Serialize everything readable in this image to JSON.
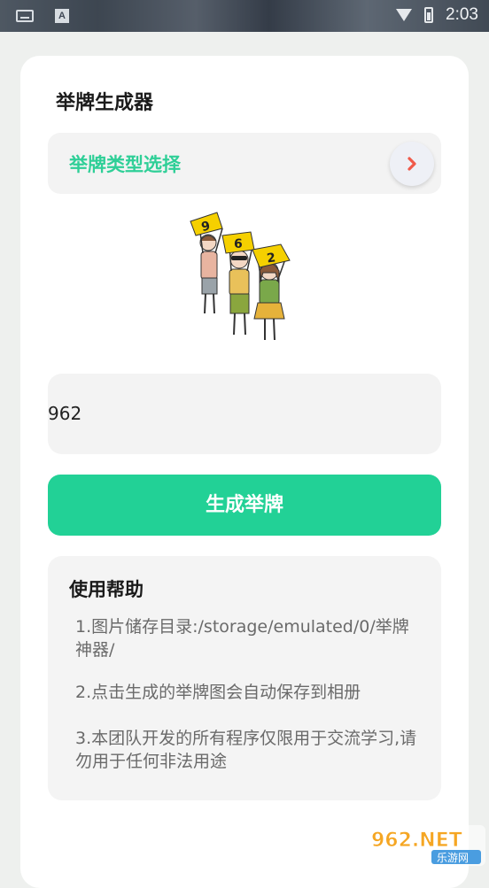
{
  "status_bar": {
    "time": "2:03",
    "icons": [
      "keyboard-icon",
      "a-icon",
      "wifi-icon",
      "battery-icon"
    ]
  },
  "header": {
    "title": "举牌生成器"
  },
  "type_select": {
    "label": "举牌类型选择",
    "icon": "chevron-right-icon"
  },
  "illustration": {
    "signs": [
      "9",
      "6",
      "2"
    ]
  },
  "input": {
    "value": "962"
  },
  "generate_button": {
    "label": "生成举牌"
  },
  "help": {
    "title": "使用帮助",
    "items": [
      "1.图片储存目录:/storage/emulated/0/举牌神器/",
      "2.点击生成的举牌图会自动保存到相册",
      "3.本团队开发的所有程序仅限用于交流学习,请勿用于任何非法用途"
    ]
  },
  "watermark": {
    "brand": "962.NET",
    "sub": "乐游网"
  },
  "colors": {
    "accent": "#22d196",
    "select_label": "#2fcf97",
    "chevron": "#f05a4a",
    "card_bg": "#ffffff",
    "page_bg": "#eef0ee",
    "field_bg": "#f3f3f3"
  }
}
